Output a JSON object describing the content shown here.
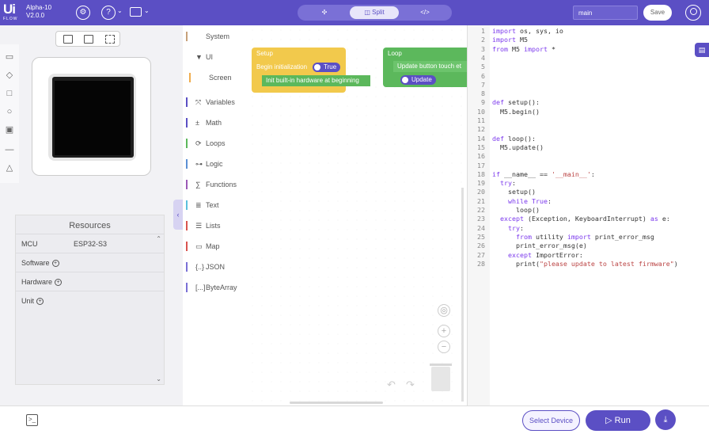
{
  "app": {
    "logo_text": "Ui",
    "logo_sub": "FLOW",
    "name": "Alpha-10",
    "version": "V2.0.0"
  },
  "topbar": {
    "modes": [
      {
        "label": "",
        "icon": "puzzle-icon"
      },
      {
        "label": "Split",
        "icon": "split-icon",
        "active": true
      },
      {
        "label": "",
        "icon": "code-icon"
      }
    ],
    "search_value": "main",
    "save_label": "Save"
  },
  "resources": {
    "title": "Resources",
    "mcu_label": "MCU",
    "mcu_value": "ESP32-S3",
    "rows": [
      "Software",
      "Hardware",
      "Unit"
    ]
  },
  "categories": [
    {
      "label": "System",
      "color": "#c7a17a",
      "icon": ""
    },
    {
      "label": "UI",
      "color": "#d9534f",
      "icon": "▼"
    },
    {
      "label": "Screen",
      "color": "#f0ad4e",
      "icon": ""
    },
    {
      "label": "Variables",
      "color": "#5b4fc4",
      "icon": "⤧"
    },
    {
      "label": "Math",
      "color": "#5b4fc4",
      "icon": "±"
    },
    {
      "label": "Loops",
      "color": "#5cb85c",
      "icon": "⟳"
    },
    {
      "label": "Logic",
      "color": "#5b8fd4",
      "icon": "⊶"
    },
    {
      "label": "Functions",
      "color": "#9b59b6",
      "icon": "∑"
    },
    {
      "label": "Text",
      "color": "#5bc0de",
      "icon": "≣"
    },
    {
      "label": "Lists",
      "color": "#d9534f",
      "icon": "☰"
    },
    {
      "label": "Map",
      "color": "#d9534f",
      "icon": "▭"
    },
    {
      "label": "JSON",
      "color": "#7a70d6",
      "icon": "{..}"
    },
    {
      "label": "ByteArray",
      "color": "#7a70d6",
      "icon": "[...]"
    }
  ],
  "blocks": {
    "setup": {
      "title": "Setup",
      "row1": "Begin initialization",
      "row1_toggle": "True",
      "row2": "Init built-in hardware at beginning"
    },
    "loop": {
      "title": "Loop",
      "row1": "Update button touch et",
      "row1_toggle": "Update"
    }
  },
  "code_lines": [
    {
      "n": "1",
      "t": "import os, sys, io"
    },
    {
      "n": "2",
      "t": "import M5"
    },
    {
      "n": "3",
      "t": "from M5 import *"
    },
    {
      "n": "4",
      "t": ""
    },
    {
      "n": "5",
      "t": ""
    },
    {
      "n": "6",
      "t": ""
    },
    {
      "n": "7",
      "t": ""
    },
    {
      "n": "8",
      "t": ""
    },
    {
      "n": "9",
      "t": "def setup():"
    },
    {
      "n": "10",
      "t": "  M5.begin()"
    },
    {
      "n": "11",
      "t": ""
    },
    {
      "n": "12",
      "t": ""
    },
    {
      "n": "14",
      "t": "def loop():"
    },
    {
      "n": "15",
      "t": "  M5.update()"
    },
    {
      "n": "16",
      "t": ""
    },
    {
      "n": "17",
      "t": ""
    },
    {
      "n": "18",
      "t": "if __name__ == '__main__':"
    },
    {
      "n": "19",
      "t": "  try:"
    },
    {
      "n": "20",
      "t": "    setup()"
    },
    {
      "n": "21",
      "t": "    while True:"
    },
    {
      "n": "22",
      "t": "      loop()"
    },
    {
      "n": "23",
      "t": "  except (Exception, KeyboardInterrupt) as e:"
    },
    {
      "n": "24",
      "t": "    try:"
    },
    {
      "n": "25",
      "t": "      from utility import print_error_msg"
    },
    {
      "n": "26",
      "t": "      print_error_msg(e)"
    },
    {
      "n": "27",
      "t": "    except ImportError:"
    },
    {
      "n": "28",
      "t": "      print(\"please update to latest firmware\")"
    }
  ],
  "bottombar": {
    "select_device_label": "Select Device",
    "run_label": "Run"
  },
  "colors": {
    "brand": "#5b4fc4",
    "setup_block": "#f2c94c",
    "loop_block": "#5cb85c"
  }
}
